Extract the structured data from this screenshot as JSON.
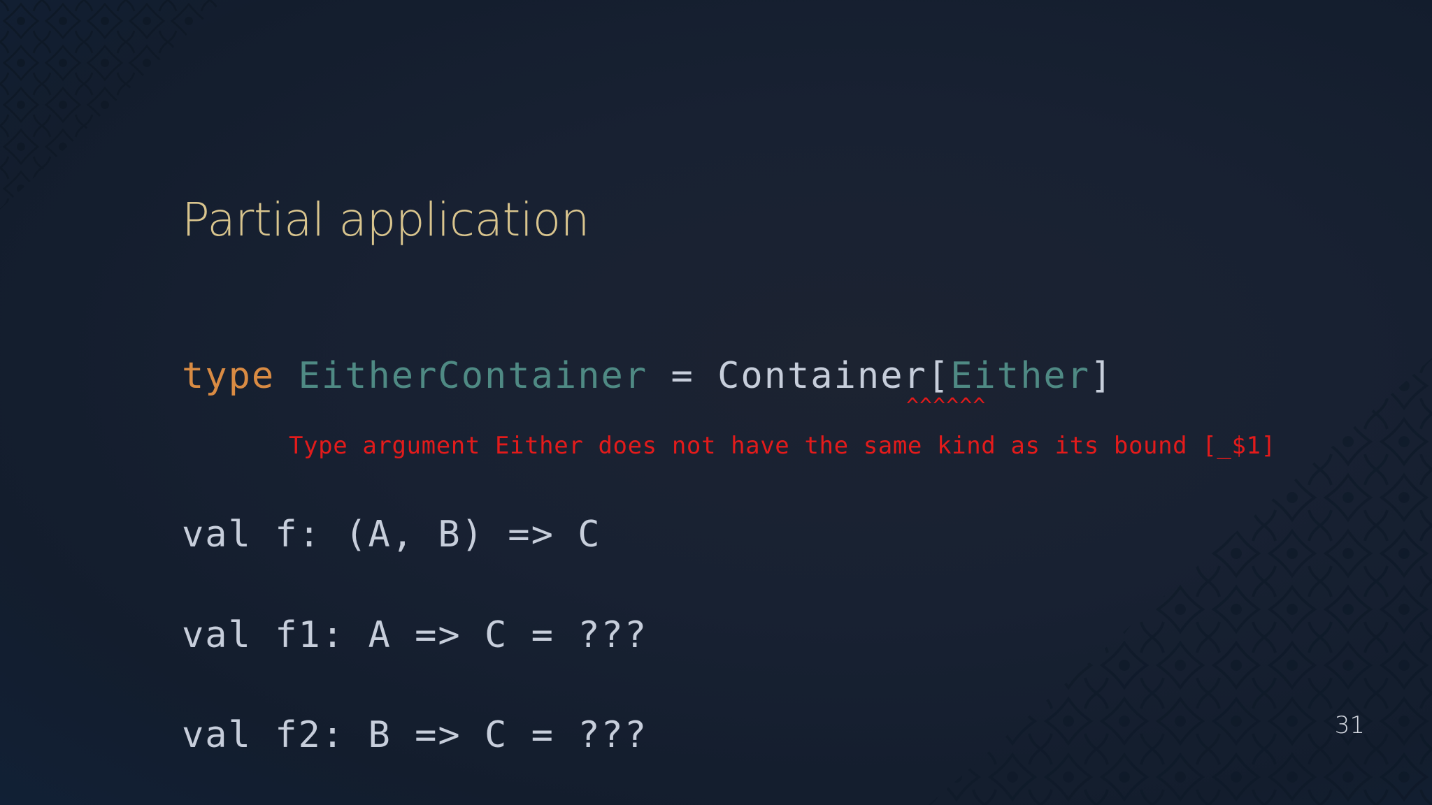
{
  "slide": {
    "title": "Partial application",
    "page_number": "31"
  },
  "code": {
    "line1": {
      "keyword": "type",
      "type_name": "EitherContainer",
      "equals": " = ",
      "container": "Container[",
      "arg": "Either",
      "close": "]"
    },
    "error": {
      "caret": "^^^^^^",
      "message": "Type argument Either does not have the same kind as its bound [_$1]"
    },
    "line2": "val f: (A, B) => C",
    "line3": "val f1: A => C = ???",
    "line4": "val f2: B => C = ???"
  },
  "colors": {
    "background": "#141d2c",
    "title": "#d9c58e",
    "keyword": "#d98b43",
    "type_name": "#4f8a84",
    "text": "#c7cedb",
    "error": "#e31b1b"
  },
  "icons": {
    "corner_top_left": "damask-ornament",
    "corner_bottom_right": "damask-ornament"
  }
}
